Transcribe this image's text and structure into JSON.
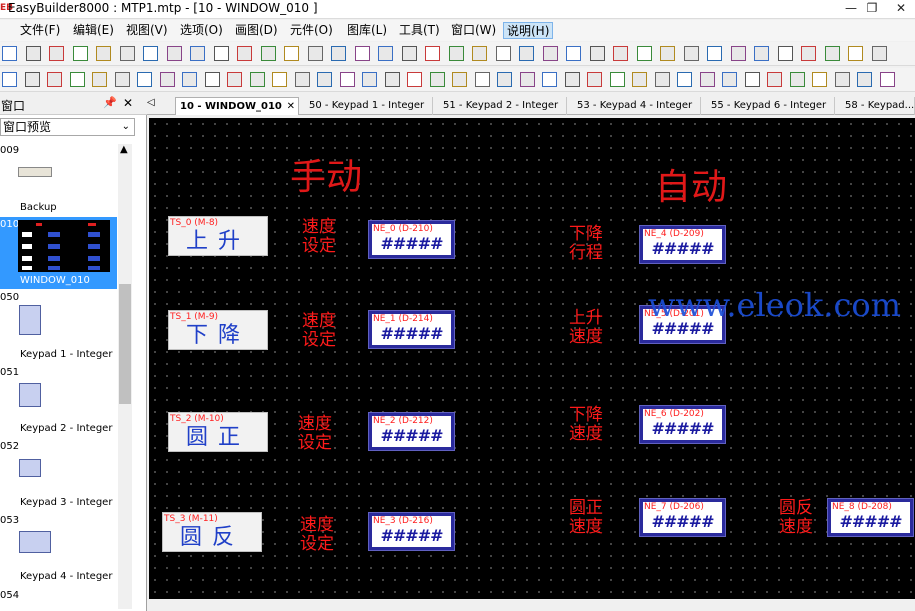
{
  "title": {
    "logo": "EB",
    "text": "EasyBuilder8000 : MTP1.mtp - [10 - WINDOW_010 ]"
  },
  "menu": [
    "文件(F)",
    "编辑(E)",
    "视图(V)",
    "选项(O)",
    "画图(D)",
    "元件(O)",
    "图库(L)",
    "工具(T)",
    "窗口(W)",
    "说明(H)"
  ],
  "sidebar": {
    "header": "窗口",
    "preview_select": "窗口预览",
    "items": [
      {
        "id": "009",
        "label": "Backup"
      },
      {
        "id": "010",
        "label": "WINDOW_010"
      },
      {
        "id": "050",
        "label": "Keypad 1 - Integer"
      },
      {
        "id": "051",
        "label": "Keypad 2 - Integer"
      },
      {
        "id": "052",
        "label": "Keypad 3 - Integer"
      },
      {
        "id": "053",
        "label": "Keypad 4 - Integer"
      },
      {
        "id": "054",
        "label": ""
      }
    ]
  },
  "tabs": [
    "10 - WINDOW_010",
    "50 - Keypad 1 - Integer",
    "51 - Keypad 2 - Integer",
    "53 - Keypad 4 - Integer",
    "55 - Keypad 6 - Integer",
    "58 - Keypad..."
  ],
  "canvas": {
    "manual_title": "手动",
    "auto_title": "自动",
    "toggle_switches": [
      {
        "tag": "TS_0 (M-8)",
        "text": "上升"
      },
      {
        "tag": "TS_1 (M-9)",
        "text": "下降"
      },
      {
        "tag": "TS_2 (M-10)",
        "text": "圆正"
      },
      {
        "tag": "TS_3 (M-11)",
        "text": "圆反"
      }
    ],
    "speed_setting_label": [
      "速度",
      "设定"
    ],
    "numeric_entries": [
      {
        "tag": "NE_0 (D-210)",
        "value": "#####"
      },
      {
        "tag": "NE_1 (D-214)",
        "value": "#####"
      },
      {
        "tag": "NE_2 (D-212)",
        "value": "#####"
      },
      {
        "tag": "NE_3 (D-216)",
        "value": "#####"
      },
      {
        "tag": "NE_4 (D-209)",
        "value": "#####"
      },
      {
        "tag": "NE_5 (D-201)",
        "value": "#####"
      },
      {
        "tag": "NE_6 (D-202)",
        "value": "#####"
      },
      {
        "tag": "NE_7 (D-206)",
        "value": "#####"
      },
      {
        "tag": "NE_8 (D-208)",
        "value": "#####"
      }
    ],
    "auto_labels": [
      [
        "下降",
        "行程"
      ],
      [
        "上升",
        "速度"
      ],
      [
        "下降",
        "速度"
      ],
      [
        "圆正",
        "速度"
      ],
      [
        "圆反",
        "速度"
      ]
    ]
  },
  "watermark": "www.eleok.com",
  "colors": {
    "canvas_bg": "#000000",
    "label_red": "#ff1a1a",
    "switch_text_blue": "#2040c8",
    "ne_border": "#2a2a9c"
  }
}
